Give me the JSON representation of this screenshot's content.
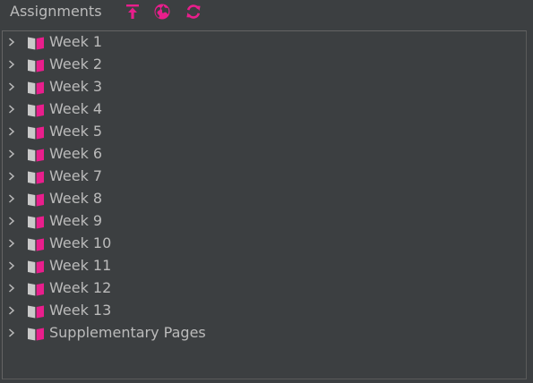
{
  "header": {
    "title": "Assignments",
    "icons": [
      "upload-icon",
      "globe-icon",
      "refresh-icon"
    ]
  },
  "colors": {
    "accent": "#e91e8c",
    "text": "#bbbbbb",
    "background": "#3c3f41",
    "border": "#646464",
    "book_page": "#c9c9c9"
  },
  "tree": {
    "items": [
      {
        "label": "Week 1"
      },
      {
        "label": "Week 2"
      },
      {
        "label": "Week 3"
      },
      {
        "label": "Week 4"
      },
      {
        "label": "Week 5"
      },
      {
        "label": "Week 6"
      },
      {
        "label": "Week 7"
      },
      {
        "label": "Week 8"
      },
      {
        "label": "Week 9"
      },
      {
        "label": "Week 10"
      },
      {
        "label": "Week 11"
      },
      {
        "label": "Week 12"
      },
      {
        "label": "Week 13"
      },
      {
        "label": "Supplementary Pages"
      }
    ]
  }
}
